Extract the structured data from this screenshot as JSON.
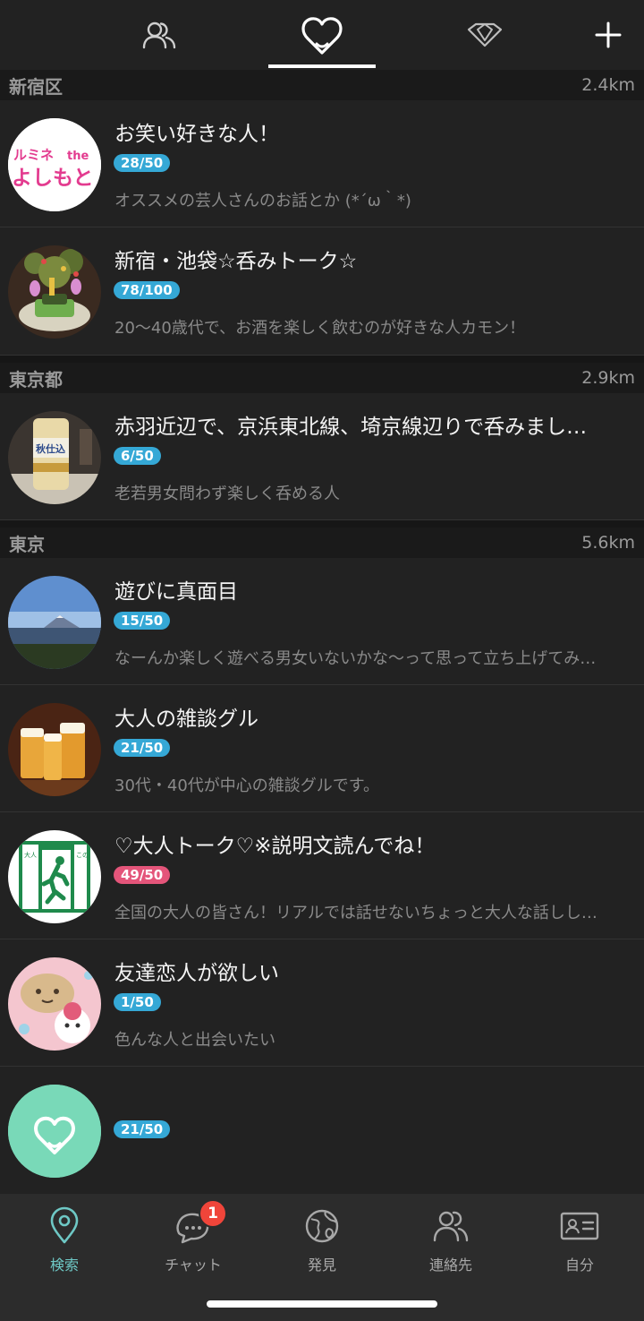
{
  "top_tabs": [
    {
      "icon": "people-icon"
    },
    {
      "icon": "group-heart-icon"
    },
    {
      "icon": "diamond-icon"
    },
    {
      "icon": "plus-icon"
    }
  ],
  "sections": [
    {
      "area": "新宿区",
      "distance": "2.4km",
      "rows": [
        {
          "title": "お笑い好きな人！",
          "count": "28/50",
          "desc": "オススメの芸人さんのお話とか (*´ω｀*)",
          "avatar_text": "ルミネ the よしもと"
        },
        {
          "title": "新宿・池袋☆呑みトーク☆",
          "count": "78/100",
          "desc": "20～40歳代で、お酒を楽しく飲むのが好きな人カモン！"
        }
      ]
    },
    {
      "area": "東京都",
      "distance": "2.9km",
      "rows": [
        {
          "title": "赤羽近辺で、京浜東北線、埼京線辺りで呑みまし…",
          "count": "6/50",
          "desc": "老若男女問わず楽しく呑める人"
        }
      ]
    },
    {
      "area": "東京",
      "distance": "5.6km",
      "rows": [
        {
          "title": "遊びに真面目",
          "count": "15/50",
          "desc": "なーんか楽しく遊べる男女いないかな〜って思って立ち上げてみ…"
        },
        {
          "title": "大人の雑談グル",
          "count": "21/50",
          "desc": "30代・40代が中心の雑談グルです。"
        },
        {
          "title": "♡大人トーク♡※説明文読んでね！",
          "count": "49/50",
          "desc": "全国の大人の皆さん！リアルでは話せないちょっと大人な話しし…",
          "avatar_text": "この先 大人の階段"
        },
        {
          "title": "友達恋人が欲しい",
          "count": "1/50",
          "desc": "色んな人と出会いたい"
        },
        {
          "title": "",
          "count": "21/50",
          "desc": ""
        }
      ]
    }
  ],
  "bottom_nav": [
    {
      "label": "検索",
      "icon": "location-pin-icon",
      "active": true
    },
    {
      "label": "チャット",
      "icon": "chat-bubble-icon",
      "badge": "1"
    },
    {
      "label": "発見",
      "icon": "globe-icon"
    },
    {
      "label": "連絡先",
      "icon": "contacts-icon"
    },
    {
      "label": "自分",
      "icon": "id-card-icon"
    }
  ],
  "colors": {
    "background": "#222222",
    "badge_blue": "#35a8d6",
    "badge_pink": "#e4557a",
    "accent_teal": "#6ec8c5",
    "notification_red": "#f0453a"
  }
}
